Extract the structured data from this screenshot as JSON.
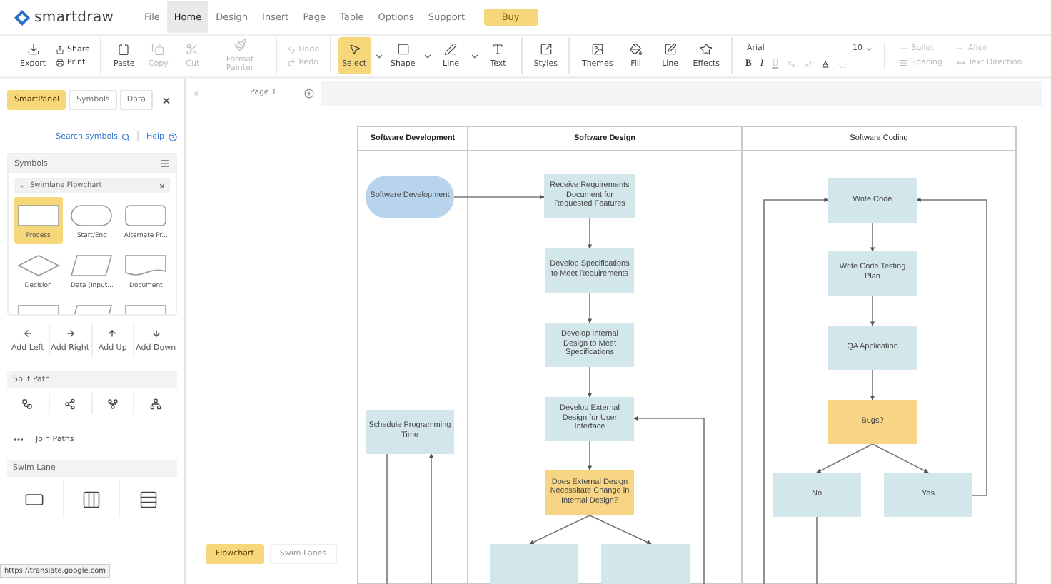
{
  "app": {
    "logo": "smartdraw"
  },
  "menu": [
    {
      "label": "File",
      "selected": false
    },
    {
      "label": "Home",
      "selected": true
    },
    {
      "label": "Design",
      "selected": false
    },
    {
      "label": "Insert",
      "selected": false
    },
    {
      "label": "Page",
      "selected": false
    },
    {
      "label": "Table",
      "selected": false
    },
    {
      "label": "Options",
      "selected": false
    },
    {
      "label": "Support",
      "selected": false
    }
  ],
  "buy_button": "Buy",
  "toolbar": {
    "groups": [
      {
        "items": [
          {
            "kind": "large",
            "label": "Export",
            "disabled": false,
            "selected": false,
            "has_menu": false
          },
          {
            "kind": "pair",
            "items": [
              {
                "label": "Share",
                "disabled": false
              },
              {
                "label": "Print",
                "disabled": false
              }
            ]
          }
        ]
      },
      {
        "items": [
          {
            "kind": "large",
            "label": "Paste",
            "disabled": false,
            "selected": false,
            "has_menu": false
          },
          {
            "kind": "large",
            "label": "Copy",
            "disabled": true,
            "selected": false,
            "has_menu": false
          },
          {
            "kind": "large",
            "label": "Cut",
            "disabled": true,
            "selected": false,
            "has_menu": false
          },
          {
            "kind": "large",
            "label": "Format Painter",
            "disabled": true,
            "selected": false,
            "has_menu": false
          }
        ]
      },
      {
        "items": [
          {
            "kind": "pair",
            "items": [
              {
                "label": "Undo",
                "disabled": true
              },
              {
                "label": "Redo",
                "disabled": true
              }
            ]
          }
        ]
      },
      {
        "items": [
          {
            "kind": "large",
            "label": "Select",
            "disabled": false,
            "selected": true,
            "has_menu": true
          },
          {
            "kind": "large",
            "label": "Shape",
            "disabled": false,
            "selected": false,
            "has_menu": true
          },
          {
            "kind": "large",
            "label": "Line",
            "disabled": false,
            "selected": false,
            "has_menu": true
          },
          {
            "kind": "large",
            "label": "Text",
            "disabled": false,
            "selected": false,
            "has_menu": false
          }
        ]
      },
      {
        "items": [
          {
            "kind": "large",
            "label": "Styles",
            "disabled": false,
            "selected": false,
            "has_menu": false
          }
        ]
      },
      {
        "items": [
          {
            "kind": "large",
            "label": "Themes",
            "disabled": false,
            "selected": false,
            "has_menu": false
          },
          {
            "kind": "large",
            "label": "Fill",
            "disabled": false,
            "selected": false,
            "has_menu": false
          },
          {
            "kind": "large",
            "label": "Line",
            "disabled": false,
            "selected": false,
            "has_menu": false
          },
          {
            "kind": "large",
            "label": "Effects",
            "disabled": false,
            "selected": false,
            "has_menu": false
          }
        ]
      }
    ],
    "font": {
      "family": "Arial",
      "size": "10"
    },
    "format_buttons": [
      {
        "kind": "bold",
        "label": "B",
        "disabled": false
      },
      {
        "kind": "italic",
        "label": "I",
        "disabled": false
      },
      {
        "kind": "underline",
        "label": "U",
        "disabled": true
      },
      {
        "kind": "subscript",
        "disabled": true
      },
      {
        "kind": "superscript",
        "disabled": true
      },
      {
        "kind": "font-color",
        "disabled": false
      },
      {
        "kind": "braces",
        "disabled": true
      }
    ],
    "paragraph": [
      {
        "label": "Bullet",
        "disabled": true
      },
      {
        "label": "Align",
        "disabled": true
      },
      {
        "label": "Spacing",
        "disabled": true
      },
      {
        "label": "Text Direction",
        "disabled": true
      }
    ]
  },
  "sidebar": {
    "tabs": [
      {
        "label": "SmartPanel",
        "selected": true
      },
      {
        "label": "Symbols",
        "selected": false
      },
      {
        "label": "Data",
        "selected": false
      }
    ],
    "search_link": "Search symbols",
    "help_link": "Help",
    "symbols": {
      "title": "Symbols",
      "library": "Swimlane Flowchart",
      "shapes": [
        {
          "kind": "rect",
          "label": "Process",
          "selected": true
        },
        {
          "kind": "pill",
          "label": "Start/End",
          "selected": false
        },
        {
          "kind": "rounded",
          "label": "Alternate Pr...",
          "selected": false
        },
        {
          "kind": "diamond",
          "label": "Decision",
          "selected": false
        },
        {
          "kind": "parallelogram",
          "label": "Data (Input...",
          "selected": false
        },
        {
          "kind": "document",
          "label": "Document",
          "selected": false
        },
        {
          "kind": "rect",
          "selected": false
        },
        {
          "kind": "parallelogram",
          "selected": false
        },
        {
          "kind": "document",
          "selected": false
        }
      ]
    },
    "add_buttons": [
      {
        "kind": "left",
        "label": "Add Left"
      },
      {
        "kind": "right",
        "label": "Add Right"
      },
      {
        "kind": "up",
        "label": "Add Up"
      },
      {
        "kind": "down",
        "label": "Add Down"
      }
    ],
    "split_path": {
      "title": "Split Path",
      "join_label": "Join Paths"
    },
    "swim_lane": {
      "title": "Swim Lane"
    },
    "status_url": "https://translate.google.com"
  },
  "canvas": {
    "page_tab": "Page 1",
    "lanes": [
      {
        "title": "Software Development"
      },
      {
        "title": "Software Design"
      },
      {
        "title": "Software Coding"
      }
    ],
    "nodes": [
      {
        "kind": "terminal",
        "text": "Software Development"
      },
      {
        "kind": "process",
        "text": "Receive Requirements Document for Requested Features"
      },
      {
        "kind": "process",
        "text": "Develop Specifications to Meet Requirements"
      },
      {
        "kind": "process",
        "text": "Develop Internal Design to Meet Specifications"
      },
      {
        "kind": "process",
        "text": "Develop External Design for User Interface"
      },
      {
        "kind": "decision",
        "text": "Does External Design Necessitate Change in Internal Design?"
      },
      {
        "kind": "process"
      },
      {
        "kind": "process"
      },
      {
        "kind": "process",
        "text": "Schedule Programming Time"
      },
      {
        "kind": "process",
        "text": "Write Code"
      },
      {
        "kind": "process",
        "text": "Write  Code Testing Plan"
      },
      {
        "kind": "process",
        "text": "QA Application"
      },
      {
        "kind": "decision",
        "text": "Bugs?"
      },
      {
        "kind": "process",
        "text": "No"
      },
      {
        "kind": "process",
        "text": "Yes"
      }
    ],
    "bottom_tabs": [
      {
        "label": "Flowchart",
        "selected": true
      },
      {
        "label": "Swim Lanes",
        "selected": false
      }
    ]
  }
}
